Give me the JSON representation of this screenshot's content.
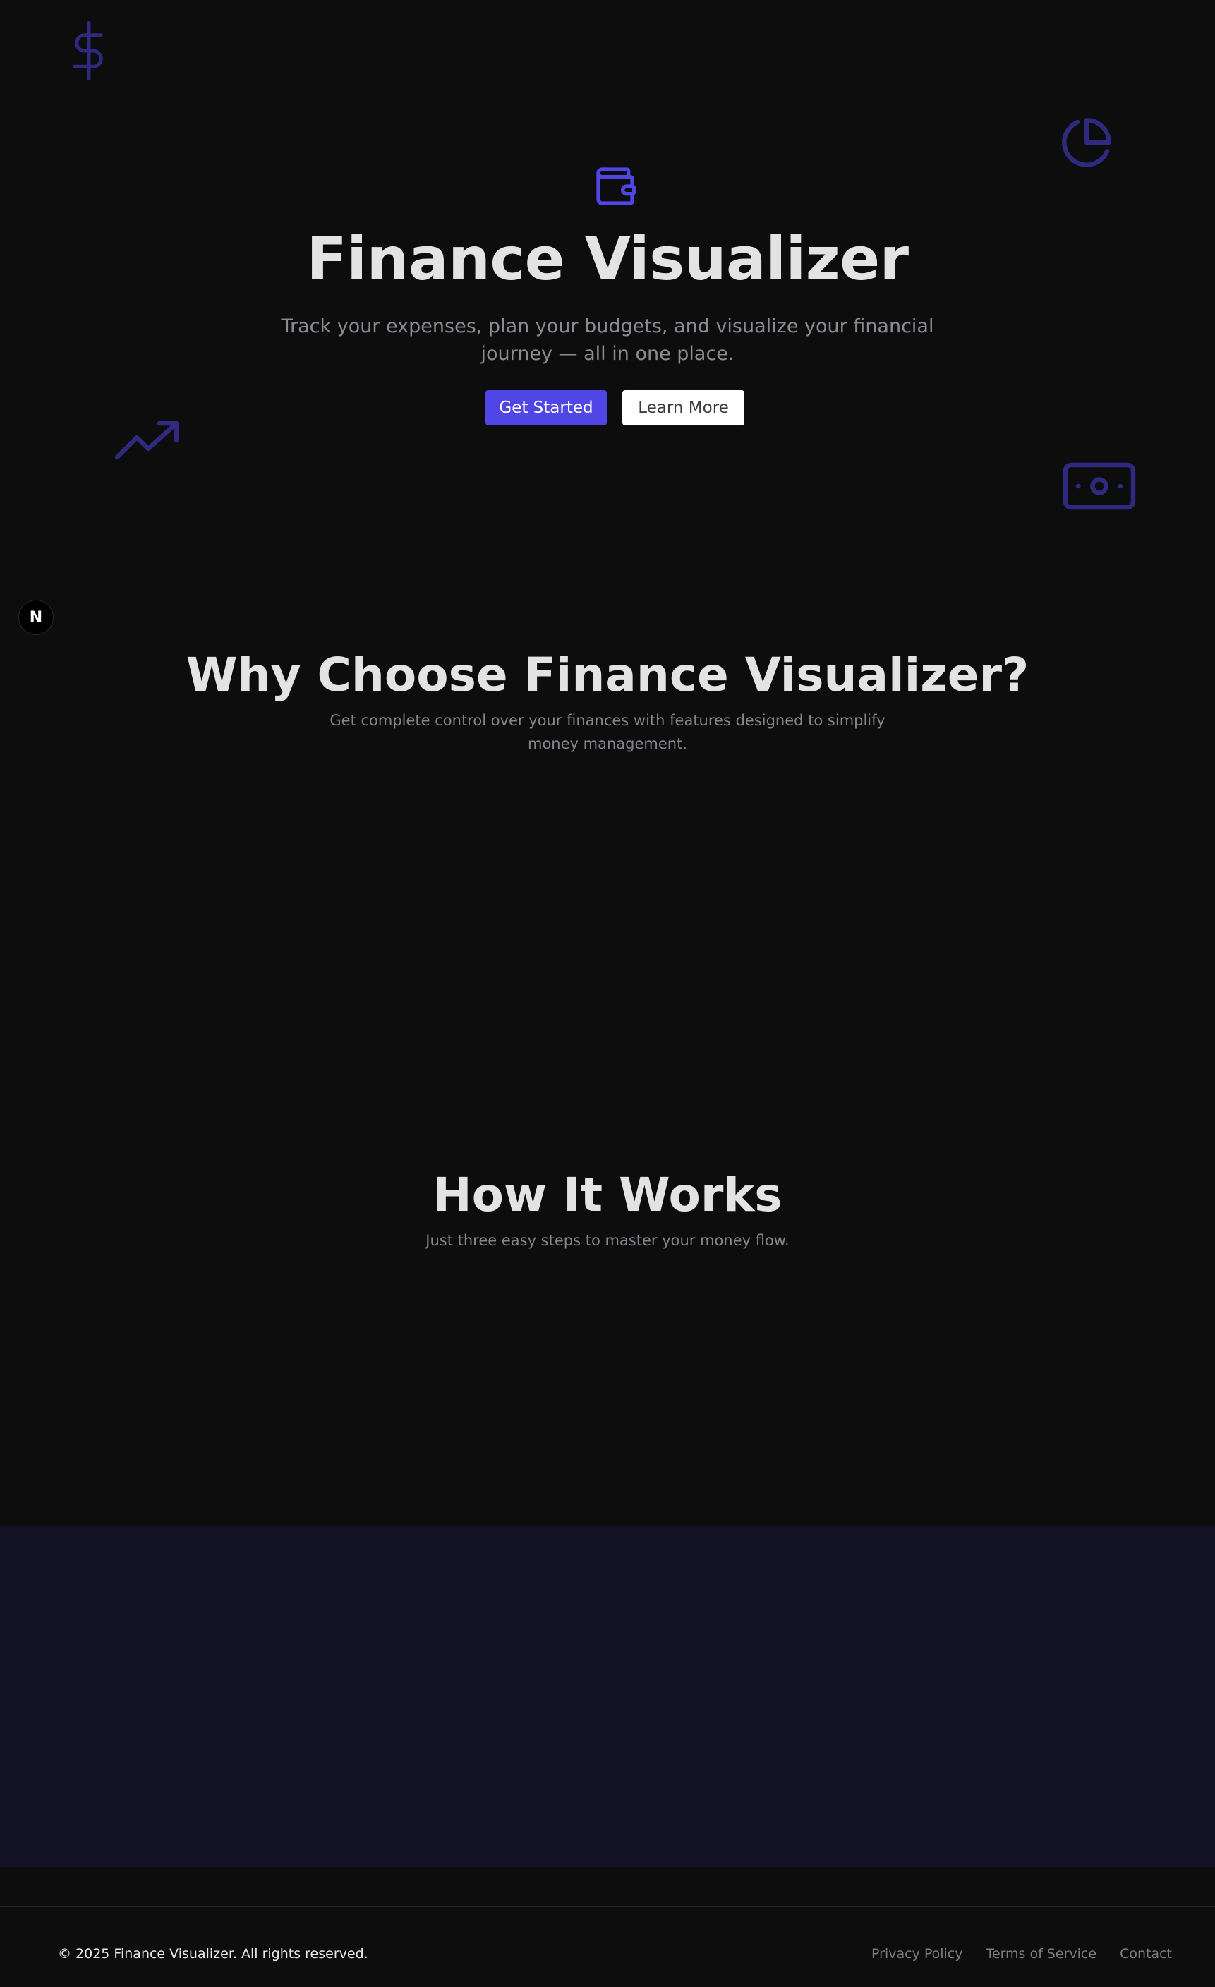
{
  "hero": {
    "title": "Finance Visualizer",
    "subtitle": "Track your expenses, plan your budgets, and visualize your financial journey — all in one place.",
    "primary_button": "Get Started",
    "secondary_button": "Learn More",
    "icon": "wallet-icon",
    "decorative_icons": [
      "dollar-icon",
      "pie-chart-icon",
      "trending-up-icon",
      "banknote-icon"
    ]
  },
  "badge": {
    "letter": "N"
  },
  "features": {
    "title": "Why Choose Finance Visualizer?",
    "subtitle": "Get complete control over your finances with features designed to simplify money management."
  },
  "how_it_works": {
    "title": "How It Works",
    "subtitle": "Just three easy steps to master your money flow."
  },
  "footer": {
    "copyright": "© 2025 Finance Visualizer. All rights reserved.",
    "links": [
      "Privacy Policy",
      "Terms of Service",
      "Contact"
    ]
  },
  "colors": {
    "background": "#0d0d0e",
    "accent": "#4f46e5",
    "decorative": "#2f2a7f",
    "band": "#131325"
  }
}
